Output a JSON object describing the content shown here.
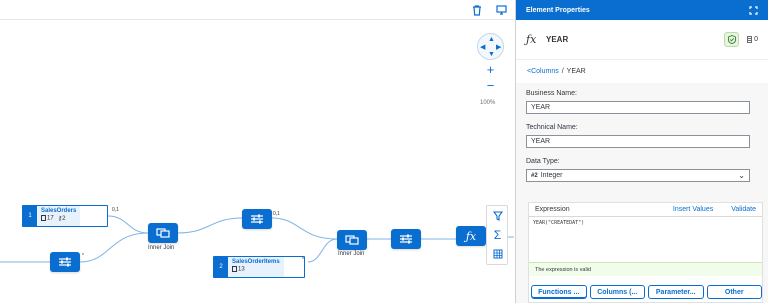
{
  "toolbar": {
    "delete_icon": "trash-icon",
    "preview_icon": "monitor-icon"
  },
  "canvas": {
    "zoom_label": "100%",
    "source_nodes": [
      {
        "index": "1",
        "name": "SalesOrders",
        "columns": "17",
        "keys": "2"
      },
      {
        "index": "2",
        "name": "SalesOrderItems",
        "columns": "13"
      }
    ],
    "cardinality": {
      "a": "0,1",
      "b": "*",
      "c": "0,1",
      "d": "*",
      "e": "*"
    },
    "join_labels": {
      "join1": "Inner Join",
      "join2": "Inner Join"
    }
  },
  "panel": {
    "header_title": "Element Properties",
    "object_name": "YEAR",
    "usage_count": "0",
    "breadcrumb": {
      "link": "<Columns",
      "separator": "/",
      "current": "YEAR"
    },
    "business_name": {
      "label": "Business Name:",
      "value": "YEAR"
    },
    "technical_name": {
      "label": "Technical Name:",
      "value": "YEAR"
    },
    "data_type": {
      "label": "Data Type:",
      "value": "Integer",
      "type_icon": "#2"
    },
    "expression": {
      "title": "Expression",
      "insert_values": "Insert Values",
      "validate": "Validate",
      "text": "YEAR(\"CREATEDAT\")",
      "status": "The expression is valid"
    },
    "tabs": [
      "Functions ...",
      "Columns (...",
      "Parameter...",
      "Other"
    ]
  },
  "colors": {
    "accent": "#0a6ed1",
    "valid_bg": "#f1fdea"
  }
}
